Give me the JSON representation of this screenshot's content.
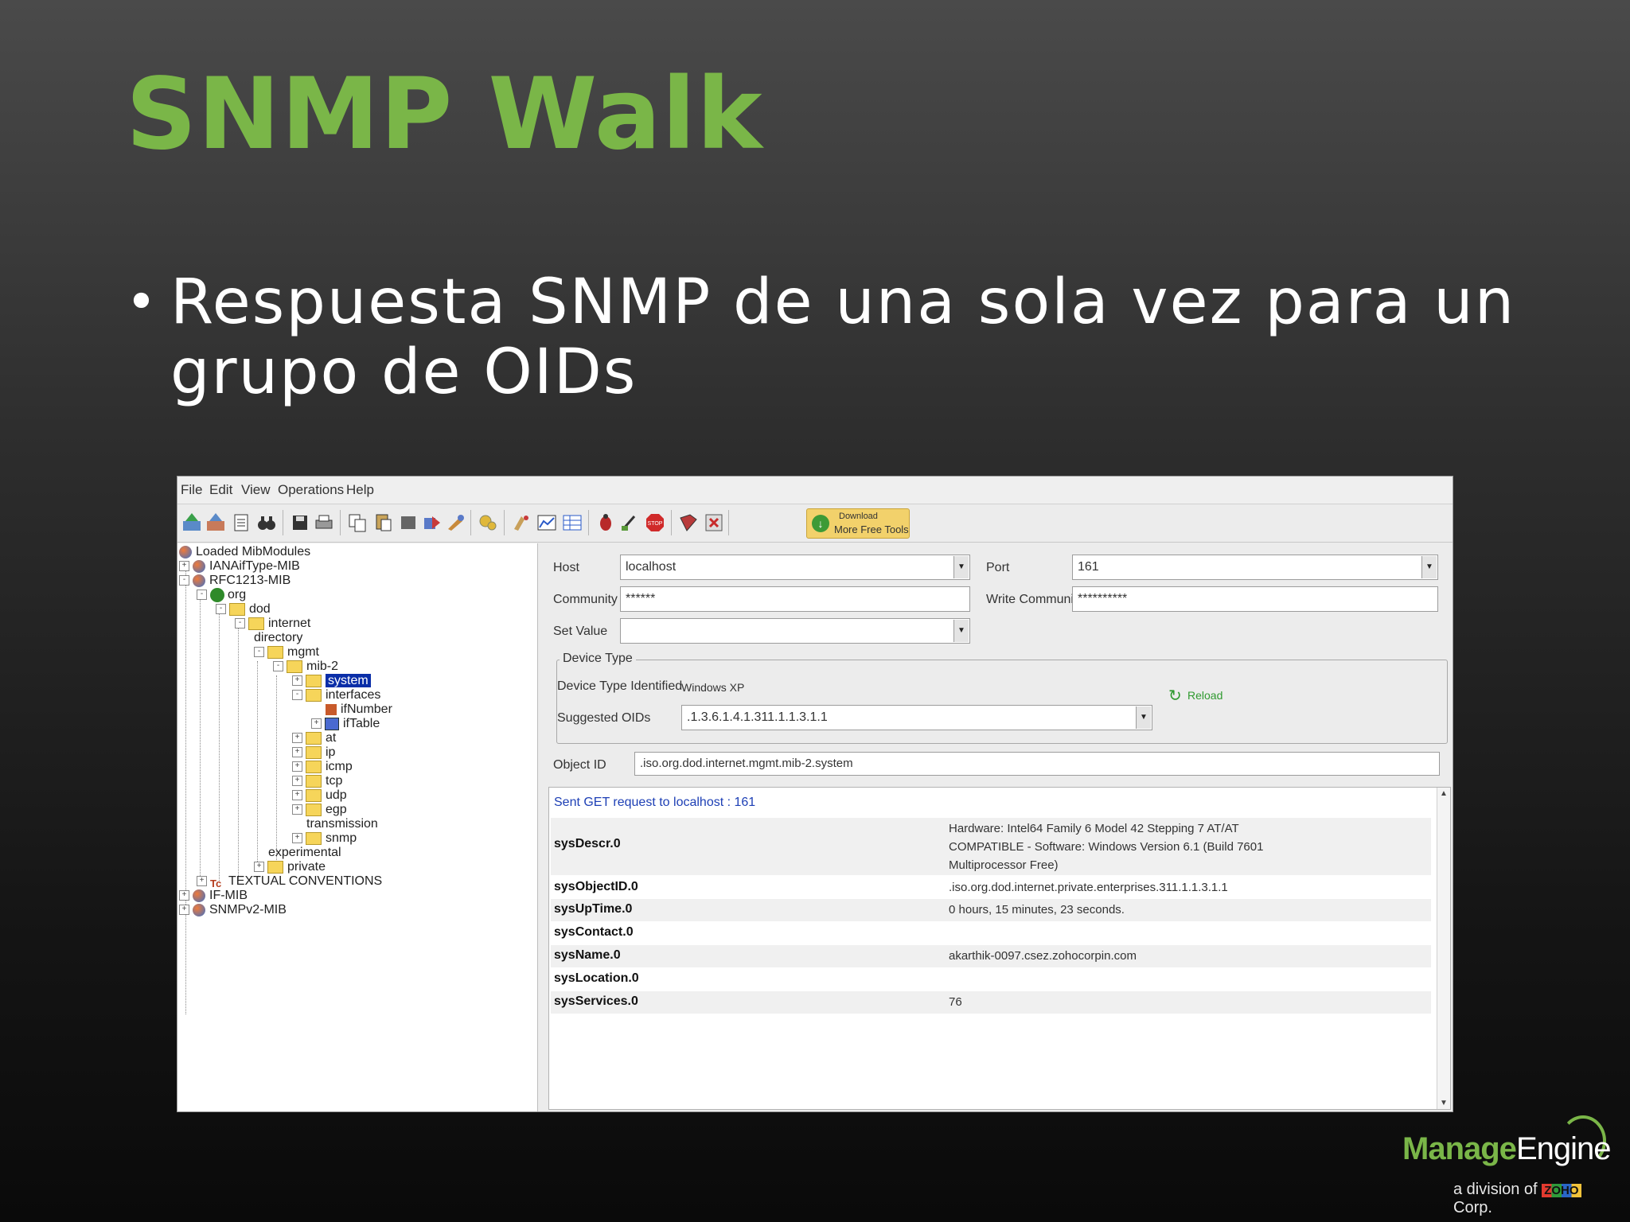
{
  "slide": {
    "title": "SNMP Walk",
    "bullet": "Respuesta SNMP de una sola vez para un grupo de OIDs",
    "bullet_marker": "•"
  },
  "menubar": [
    "File",
    "Edit",
    "View",
    "Operations",
    "Help"
  ],
  "toolbar": {
    "download_line1": "Download",
    "download_line2": "More Free Tools"
  },
  "tree": {
    "root": "Loaded MibModules",
    "nodes": [
      "IANAifType-MIB",
      "RFC1213-MIB",
      "org",
      "dod",
      "internet",
      "directory",
      "mgmt",
      "mib-2",
      "system",
      "interfaces",
      "ifNumber",
      "ifTable",
      "at",
      "ip",
      "icmp",
      "tcp",
      "udp",
      "egp",
      "transmission",
      "snmp",
      "experimental",
      "private",
      "TEXTUAL CONVENTIONS",
      "IF-MIB",
      "SNMPv2-MIB"
    ],
    "selected": "system"
  },
  "form": {
    "host_label": "Host",
    "host_value": "localhost",
    "port_label": "Port",
    "port_value": "161",
    "community_label": "Community",
    "community_value": "******",
    "write_community_label": "Write Community",
    "write_community_value": "**********",
    "set_value_label": "Set Value",
    "set_value_value": "",
    "device_type_title": "Device Type",
    "device_type_identified_label": "Device Type Identified",
    "device_type_identified_value": "Windows XP",
    "reload_label": "Reload",
    "suggested_oids_label": "Suggested OIDs",
    "suggested_oids_value": ".1.3.6.1.4.1.311.1.1.3.1.1",
    "object_id_label": "Object ID",
    "object_id_value": ".iso.org.dod.internet.mgmt.mib-2.system"
  },
  "results": {
    "sent_message": "Sent GET request to localhost : 161",
    "rows": [
      {
        "name": "sysDescr.0",
        "value": "Hardware: Intel64 Family 6 Model 42 Stepping 7 AT/AT COMPATIBLE - Software: Windows Version 6.1 (Build 7601 Multiprocessor Free)"
      },
      {
        "name": "sysObjectID.0",
        "value": ".iso.org.dod.internet.private.enterprises.311.1.1.3.1.1"
      },
      {
        "name": "sysUpTime.0",
        "value": "0 hours, 15 minutes, 23 seconds."
      },
      {
        "name": "sysContact.0",
        "value": ""
      },
      {
        "name": "sysName.0",
        "value": "akarthik-0097.csez.zohocorpin.com"
      },
      {
        "name": "sysLocation.0",
        "value": ""
      },
      {
        "name": "sysServices.0",
        "value": "76"
      }
    ]
  },
  "logo": {
    "brand_manage": "Manage",
    "brand_engine": "Engine",
    "sub_prefix": "a division of",
    "sub_zoho": "ZOHO",
    "sub_suffix": "Corp."
  },
  "colors": {
    "title_green": "#7ab648",
    "selection_blue": "#0a2ea8",
    "link_blue": "#1d3fb5"
  }
}
